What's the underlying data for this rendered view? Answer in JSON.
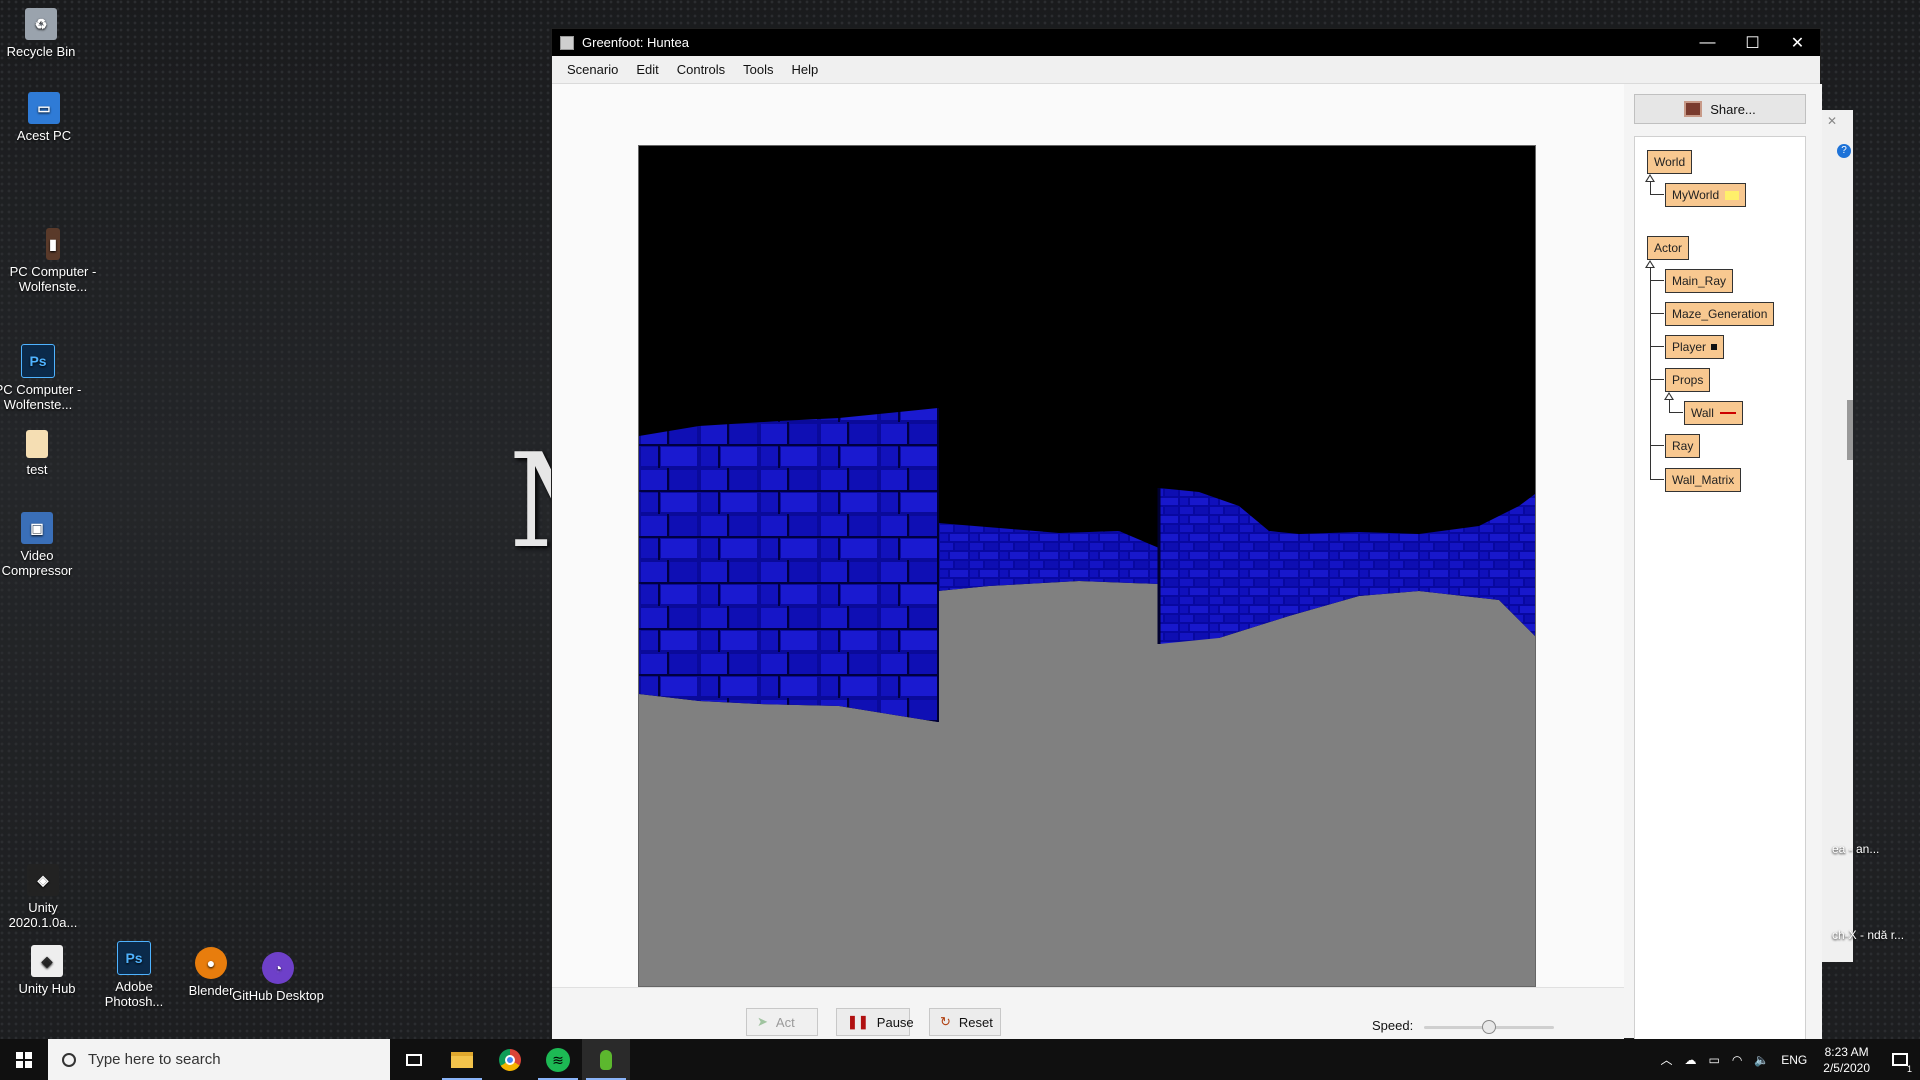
{
  "desktop": {
    "icons": [
      {
        "label": "Recycle Bin",
        "icon": "recycle-bin-icon"
      },
      {
        "label": "Acest PC",
        "icon": "computer-icon"
      },
      {
        "label": "PC Computer - Wolfenste...",
        "icon": "game-file-icon"
      },
      {
        "label": "PC Computer - Wolfenste...",
        "icon": "photoshop-file-icon"
      },
      {
        "label": "test",
        "icon": "folder-icon"
      },
      {
        "label": "Video Compressor",
        "icon": "video-compressor-icon"
      },
      {
        "label": "Unity 2020.1.0a...",
        "icon": "unity-icon"
      },
      {
        "label": "Unity Hub",
        "icon": "unity-hub-icon"
      },
      {
        "label": "Adobe Photosh...",
        "icon": "photoshop-icon"
      },
      {
        "label": "Blender",
        "icon": "blender-icon"
      },
      {
        "label": "GitHub Desktop",
        "icon": "github-desktop-icon"
      }
    ],
    "right_partial_labels": [
      "ea - an...",
      "ch-X - ndă r..."
    ],
    "wallpaper_letter": "M"
  },
  "window": {
    "title": "Greenfoot: Huntea",
    "controls": {
      "minimize": "—",
      "maximize": "☐",
      "close": "✕"
    },
    "menu": [
      "Scenario",
      "Edit",
      "Controls",
      "Tools",
      "Help"
    ],
    "share_label": "Share...",
    "buttons": {
      "act": "Act",
      "pause": "Pause",
      "reset": "Reset"
    },
    "speed_label": "Speed:",
    "speed_value": 0.5,
    "class_tree": {
      "world_root": "World",
      "world_children": [
        "MyWorld"
      ],
      "actor_root": "Actor",
      "actor_children": [
        "Main_Ray",
        "Maze_Generation",
        "Player",
        "Props",
        "Ray",
        "Wall_Matrix"
      ],
      "props_children": [
        "Wall"
      ]
    },
    "colors": {
      "class_fill": "#f8c890",
      "wall_blue": "#0a0aa8",
      "floor": "#808080",
      "sky": "#000000"
    }
  },
  "taskbar": {
    "search_placeholder": "Type here to search",
    "apps": [
      "task-view-icon",
      "file-explorer-icon",
      "chrome-icon",
      "spotify-icon",
      "greenfoot-icon"
    ],
    "language": "ENG",
    "time": "8:23 AM",
    "date": "2/5/2020",
    "notification_count": "1"
  }
}
